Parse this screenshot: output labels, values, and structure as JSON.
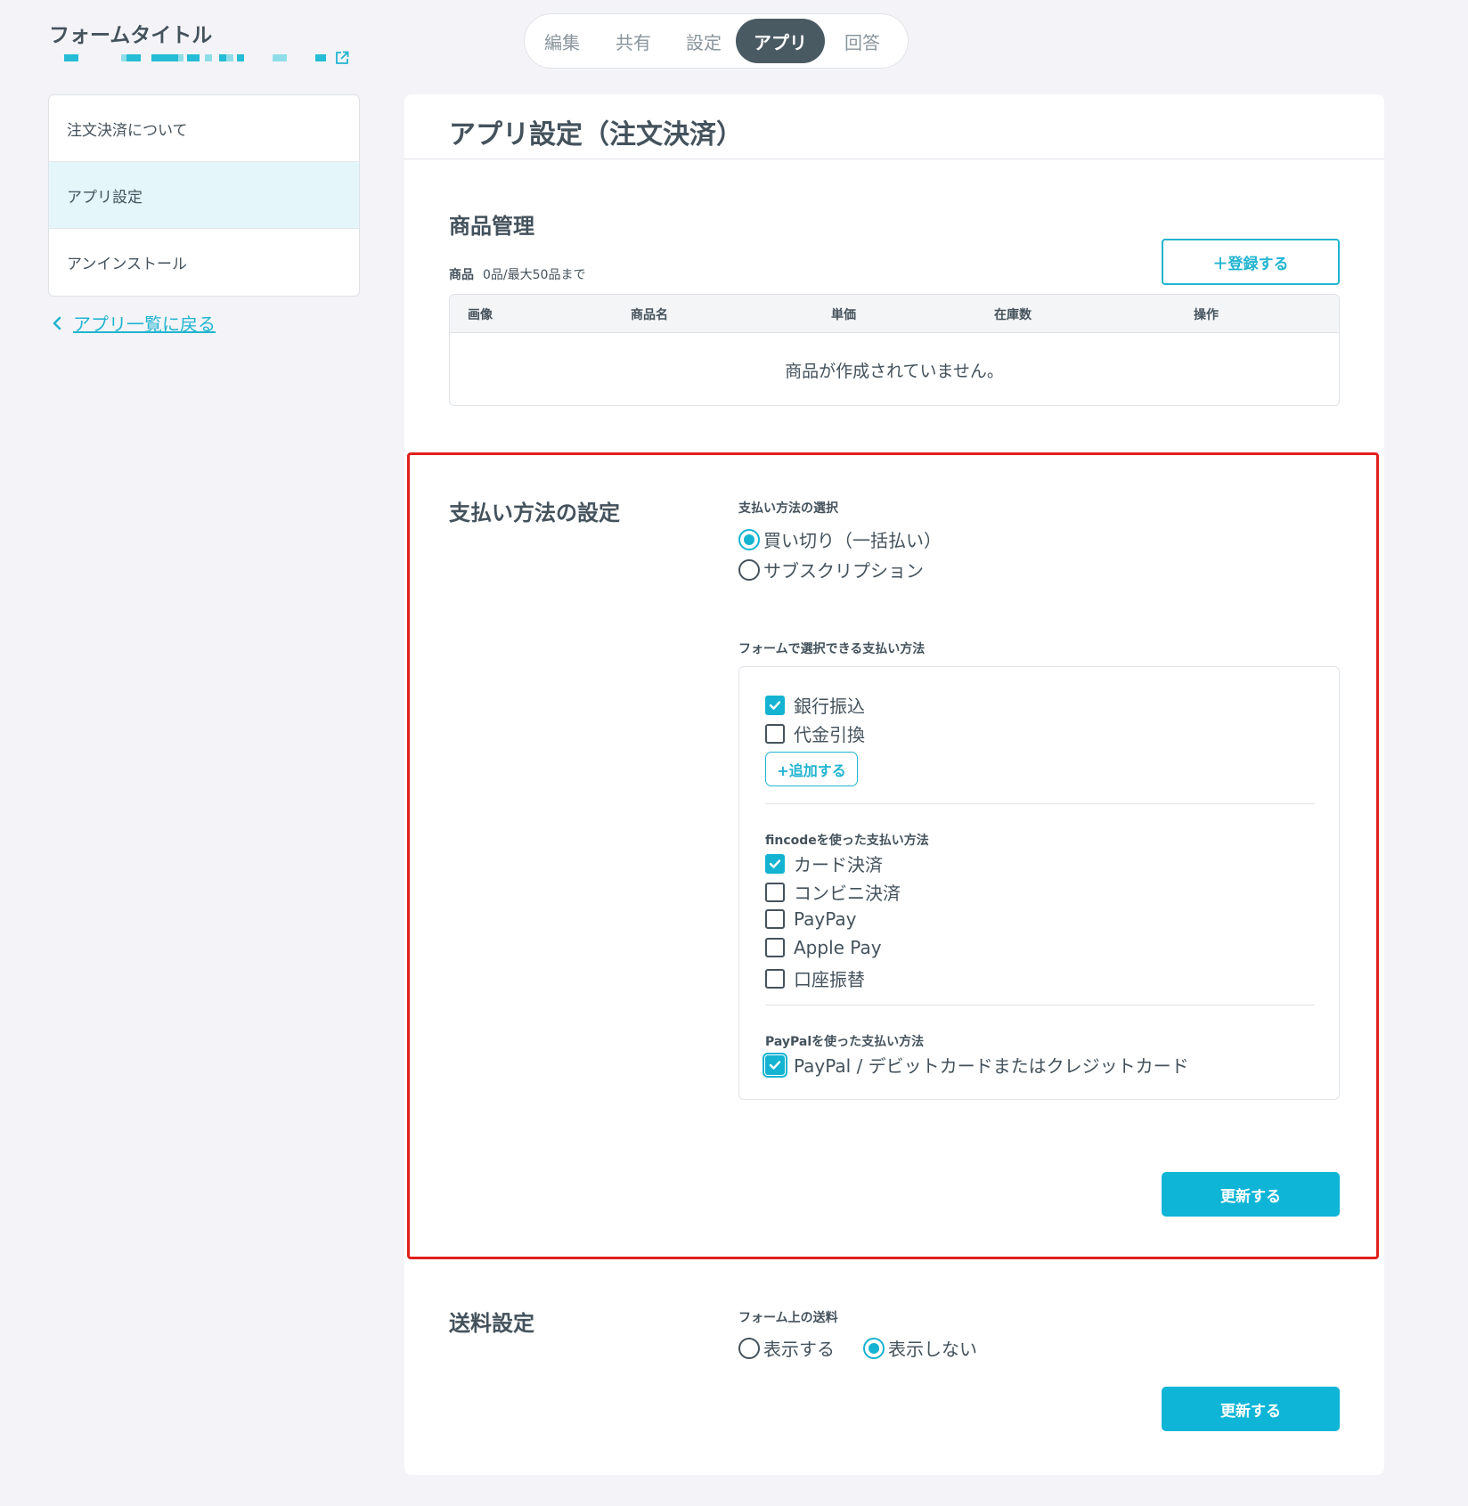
{
  "header": {
    "form_title": "フォームタイトル"
  },
  "tabs": [
    {
      "label": "編集",
      "active": false
    },
    {
      "label": "共有",
      "active": false
    },
    {
      "label": "設定",
      "active": false
    },
    {
      "label": "アプリ",
      "active": true
    },
    {
      "label": "回答",
      "active": false
    }
  ],
  "sidebar": {
    "items": [
      {
        "label": "注文決済について",
        "active": false
      },
      {
        "label": "アプリ設定",
        "active": true
      },
      {
        "label": "アンインストール",
        "active": false
      }
    ],
    "back_link": "アプリ一覧に戻る"
  },
  "main": {
    "title": "アプリ設定（注文決済）",
    "products": {
      "heading": "商品管理",
      "count_label": "商品",
      "count_text": "0品/最大50品まで",
      "register_button": "＋登録する",
      "columns": [
        "画像",
        "商品名",
        "単価",
        "在庫数",
        "操作"
      ],
      "empty_message": "商品が作成されていません。"
    },
    "payment": {
      "heading": "支払い方法の設定",
      "select_label": "支払い方法の選択",
      "options": [
        {
          "label": "買い切り（一括払い）",
          "selected": true
        },
        {
          "label": "サブスクリプション",
          "selected": false
        }
      ],
      "methods_label": "フォームで選択できる支払い方法",
      "basic_methods": [
        {
          "label": "銀行振込",
          "checked": true
        },
        {
          "label": "代金引換",
          "checked": false
        }
      ],
      "add_button": "+追加する",
      "fincode_label": "fincodeを使った支払い方法",
      "fincode_methods": [
        {
          "label": "カード決済",
          "checked": true
        },
        {
          "label": "コンビニ決済",
          "checked": false
        },
        {
          "label": "PayPay",
          "checked": false
        },
        {
          "label": "Apple Pay",
          "checked": false
        },
        {
          "label": "口座振替",
          "checked": false
        }
      ],
      "paypal_label": "PayPalを使った支払い方法",
      "paypal_methods": [
        {
          "label": "PayPal / デビットカードまたはクレジットカード",
          "checked": true
        }
      ],
      "update_button": "更新する"
    },
    "shipping": {
      "heading": "送料設定",
      "label": "フォーム上の送料",
      "options": [
        {
          "label": "表示する",
          "selected": false
        },
        {
          "label": "表示しない",
          "selected": true
        }
      ],
      "update_button": "更新する"
    }
  },
  "colors": {
    "accent": "#14b3d2",
    "highlight_border": "#e0201b",
    "tab_active_bg": "#4a5a63"
  }
}
